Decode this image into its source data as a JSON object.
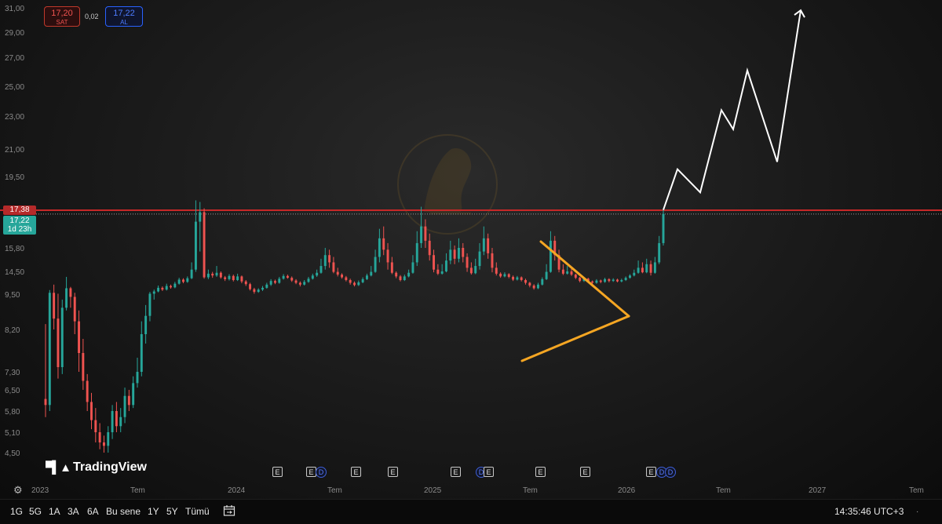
{
  "quote": {
    "sell_price": "17,20",
    "sell_label": "SAT",
    "spread": "0,02",
    "buy_price": "17,22",
    "buy_label": "AL"
  },
  "price_badges": {
    "red_value": "17,38",
    "green_value": "17,22",
    "green_countdown": "1d 23h"
  },
  "brand": "TradingView",
  "bottom_bar": {
    "timeframes": [
      "1G",
      "5G",
      "1A",
      "3A",
      "6A",
      "Bu sene",
      "1Y",
      "5Y",
      "Tümü"
    ],
    "clock": "14:35:46 UTC+3"
  },
  "colors": {
    "up": "#26a69a",
    "down": "#ef5350",
    "resistance": "#c62828",
    "pattern": "#f5a623",
    "projection": "#ffffff"
  },
  "chart_data": {
    "type": "candlestick",
    "y_ticks": [
      "31,00",
      "29,00",
      "27,00",
      "25,00",
      "23,00",
      "21,00",
      "19,50",
      "17,38",
      "15,80",
      "14,50",
      "9,50",
      "8,20",
      "7,30",
      "6,50",
      "5,80",
      "5,10",
      "4,50"
    ],
    "x_ticks": [
      "2023",
      "Tem",
      "2024",
      "Tem",
      "2025",
      "Tem",
      "2026",
      "Tem",
      "2027",
      "Tem"
    ],
    "resistance_level": 17.38,
    "last_price": 17.22,
    "ohlc": [
      [
        6.2,
        6.0,
        8.4,
        5.6
      ],
      [
        6.0,
        9.8,
        10.4,
        5.8
      ],
      [
        9.8,
        8.6,
        11.6,
        8.2
      ],
      [
        8.6,
        7.4,
        9.6,
        7.0
      ],
      [
        7.4,
        9.0,
        9.3,
        7.2
      ],
      [
        9.0,
        10.8,
        13.3,
        8.9
      ],
      [
        10.8,
        9.4,
        11.1,
        9.0
      ],
      [
        9.4,
        8.5,
        9.8,
        8.1
      ],
      [
        8.5,
        7.7,
        8.9,
        7.3
      ],
      [
        7.7,
        6.9,
        8.0,
        6.5
      ],
      [
        6.9,
        6.1,
        7.2,
        5.8
      ],
      [
        6.1,
        5.5,
        6.4,
        5.2
      ],
      [
        5.5,
        5.1,
        5.9,
        4.8
      ],
      [
        5.1,
        4.8,
        5.4,
        4.6
      ],
      [
        4.8,
        4.7,
        5.0,
        4.5
      ],
      [
        4.7,
        5.1,
        5.3,
        4.5
      ],
      [
        5.1,
        5.8,
        6.0,
        4.9
      ],
      [
        5.8,
        5.3,
        6.1,
        5.1
      ],
      [
        5.3,
        5.6,
        5.9,
        5.1
      ],
      [
        5.6,
        6.3,
        6.6,
        5.4
      ],
      [
        6.3,
        6.0,
        6.5,
        5.8
      ],
      [
        6.0,
        6.8,
        7.1,
        5.9
      ],
      [
        6.8,
        7.3,
        7.6,
        6.6
      ],
      [
        7.3,
        8.1,
        8.5,
        7.1
      ],
      [
        8.1,
        8.7,
        9.1,
        7.9
      ],
      [
        8.7,
        9.6,
        10.0,
        8.5
      ],
      [
        9.6,
        10.1,
        10.5,
        9.3
      ],
      [
        10.1,
        10.9,
        11.4,
        9.9
      ],
      [
        10.9,
        10.5,
        11.2,
        10.2
      ],
      [
        10.5,
        11.3,
        11.8,
        10.3
      ],
      [
        11.3,
        11.0,
        11.6,
        10.7
      ],
      [
        11.0,
        11.8,
        12.2,
        10.8
      ],
      [
        11.8,
        12.7,
        13.1,
        11.6
      ],
      [
        12.7,
        12.2,
        13.0,
        11.9
      ],
      [
        12.2,
        13.0,
        13.4,
        12.0
      ],
      [
        13.0,
        14.6,
        15.0,
        12.8
      ],
      [
        14.6,
        16.9,
        18.0,
        14.4
      ],
      [
        16.9,
        17.3,
        17.9,
        15.6
      ],
      [
        17.3,
        13.2,
        17.5,
        12.9
      ],
      [
        13.2,
        14.0,
        14.6,
        12.8
      ],
      [
        14.0,
        13.6,
        14.4,
        13.1
      ],
      [
        13.6,
        14.2,
        14.8,
        13.3
      ],
      [
        14.2,
        13.2,
        14.5,
        12.9
      ],
      [
        13.2,
        12.8,
        13.5,
        12.4
      ],
      [
        12.8,
        13.5,
        13.9,
        12.5
      ],
      [
        13.5,
        12.6,
        13.8,
        12.3
      ],
      [
        12.6,
        13.4,
        14.0,
        12.4
      ],
      [
        13.4,
        12.3,
        13.6,
        11.9
      ],
      [
        12.3,
        11.7,
        12.6,
        11.3
      ],
      [
        11.7,
        10.6,
        12.0,
        10.3
      ],
      [
        10.6,
        10.0,
        10.9,
        9.6
      ],
      [
        10.0,
        10.5,
        10.8,
        9.8
      ],
      [
        10.5,
        10.9,
        11.3,
        10.2
      ],
      [
        10.9,
        11.6,
        12.0,
        10.7
      ],
      [
        11.6,
        12.4,
        12.8,
        11.3
      ],
      [
        12.4,
        12.0,
        12.7,
        11.7
      ],
      [
        12.0,
        12.9,
        13.3,
        11.8
      ],
      [
        12.9,
        13.5,
        13.9,
        12.7
      ],
      [
        13.5,
        13.1,
        13.8,
        12.9
      ],
      [
        13.1,
        12.5,
        13.4,
        12.2
      ],
      [
        12.5,
        12.0,
        12.8,
        11.7
      ],
      [
        12.0,
        11.6,
        12.3,
        11.2
      ],
      [
        11.6,
        12.2,
        12.6,
        11.4
      ],
      [
        12.2,
        12.9,
        13.3,
        12.0
      ],
      [
        12.9,
        13.6,
        14.0,
        12.7
      ],
      [
        13.6,
        14.2,
        14.6,
        13.3
      ],
      [
        14.2,
        14.8,
        15.2,
        14.0
      ],
      [
        14.8,
        15.4,
        15.8,
        14.6
      ],
      [
        15.4,
        15.0,
        15.7,
        14.7
      ],
      [
        15.0,
        14.4,
        15.3,
        14.1
      ],
      [
        14.4,
        13.8,
        14.7,
        13.4
      ],
      [
        13.8,
        13.2,
        14.1,
        12.9
      ],
      [
        13.2,
        12.6,
        13.5,
        12.3
      ],
      [
        12.6,
        12.0,
        12.9,
        11.6
      ],
      [
        12.0,
        11.5,
        12.3,
        11.2
      ],
      [
        11.5,
        12.1,
        12.5,
        11.3
      ],
      [
        12.1,
        12.8,
        13.2,
        11.9
      ],
      [
        12.8,
        13.6,
        14.0,
        12.6
      ],
      [
        13.6,
        14.4,
        14.8,
        13.4
      ],
      [
        14.4,
        15.3,
        15.7,
        14.2
      ],
      [
        15.3,
        16.2,
        16.6,
        15.0
      ],
      [
        16.2,
        15.7,
        16.7,
        15.4
      ],
      [
        15.7,
        15.0,
        16.0,
        14.6
      ],
      [
        15.0,
        14.2,
        15.3,
        13.9
      ],
      [
        14.2,
        13.4,
        14.5,
        13.0
      ],
      [
        13.4,
        12.6,
        13.7,
        12.3
      ],
      [
        12.6,
        13.4,
        13.8,
        12.4
      ],
      [
        13.4,
        14.2,
        14.6,
        13.2
      ],
      [
        14.2,
        15.0,
        15.4,
        14.0
      ],
      [
        15.0,
        16.0,
        16.5,
        14.8
      ],
      [
        16.0,
        16.7,
        17.6,
        15.8
      ],
      [
        16.7,
        16.1,
        17.0,
        15.8
      ],
      [
        16.1,
        15.4,
        16.4,
        15.1
      ],
      [
        15.4,
        14.6,
        15.7,
        14.3
      ],
      [
        14.6,
        14.0,
        14.9,
        13.7
      ],
      [
        14.0,
        14.5,
        14.9,
        13.8
      ],
      [
        14.5,
        15.1,
        15.5,
        14.3
      ],
      [
        15.1,
        15.7,
        16.1,
        14.9
      ],
      [
        15.7,
        15.2,
        15.9,
        14.9
      ],
      [
        15.2,
        15.8,
        16.2,
        15.0
      ],
      [
        15.8,
        15.3,
        16.0,
        15.0
      ],
      [
        15.3,
        14.7,
        15.5,
        14.4
      ],
      [
        14.7,
        14.1,
        15.0,
        13.8
      ],
      [
        14.1,
        14.8,
        15.2,
        13.9
      ],
      [
        14.8,
        15.6,
        16.0,
        14.6
      ],
      [
        15.6,
        16.2,
        16.7,
        15.4
      ],
      [
        16.2,
        15.5,
        16.4,
        15.2
      ],
      [
        15.5,
        14.7,
        15.8,
        14.3
      ],
      [
        14.7,
        14.0,
        15.0,
        13.6
      ],
      [
        14.0,
        13.4,
        14.3,
        13.1
      ],
      [
        13.4,
        13.9,
        14.3,
        13.2
      ],
      [
        13.9,
        13.3,
        14.1,
        13.0
      ],
      [
        13.3,
        12.7,
        13.6,
        12.4
      ],
      [
        12.7,
        13.2,
        13.5,
        12.5
      ],
      [
        13.2,
        12.6,
        13.4,
        12.3
      ],
      [
        12.6,
        12.0,
        12.9,
        11.6
      ],
      [
        12.0,
        11.4,
        12.2,
        11.0
      ],
      [
        11.4,
        10.8,
        11.7,
        10.5
      ],
      [
        10.8,
        11.6,
        12.0,
        10.6
      ],
      [
        11.6,
        12.8,
        13.2,
        11.4
      ],
      [
        12.8,
        14.4,
        14.9,
        12.6
      ],
      [
        14.4,
        16.1,
        16.5,
        14.2
      ],
      [
        16.1,
        15.4,
        16.3,
        15.1
      ],
      [
        15.4,
        14.6,
        15.7,
        14.3
      ],
      [
        14.6,
        14.0,
        14.9,
        13.7
      ],
      [
        14.0,
        14.5,
        14.8,
        13.8
      ],
      [
        14.5,
        13.8,
        14.7,
        13.5
      ],
      [
        13.8,
        13.1,
        14.0,
        12.8
      ],
      [
        13.1,
        12.4,
        13.3,
        12.1
      ],
      [
        12.4,
        12.9,
        13.2,
        12.2
      ],
      [
        12.9,
        12.3,
        13.1,
        12.0
      ],
      [
        12.3,
        12.0,
        12.5,
        11.7
      ],
      [
        12.0,
        12.5,
        12.8,
        11.8
      ],
      [
        12.5,
        12.2,
        12.7,
        11.9
      ],
      [
        12.2,
        12.8,
        13.1,
        12.0
      ],
      [
        12.8,
        12.4,
        13.0,
        12.1
      ],
      [
        12.4,
        12.7,
        13.0,
        12.2
      ],
      [
        12.7,
        12.3,
        12.9,
        12.1
      ],
      [
        12.3,
        12.6,
        12.9,
        12.1
      ],
      [
        12.6,
        13.1,
        13.4,
        12.4
      ],
      [
        13.1,
        13.6,
        13.9,
        12.9
      ],
      [
        13.6,
        14.2,
        14.6,
        13.4
      ],
      [
        14.2,
        14.7,
        15.1,
        14.0
      ],
      [
        14.7,
        14.3,
        15.0,
        14.1
      ],
      [
        14.3,
        14.9,
        15.2,
        14.1
      ],
      [
        14.9,
        14.2,
        15.1,
        13.6
      ],
      [
        14.2,
        15.0,
        15.3,
        14.0
      ],
      [
        15.0,
        16.0,
        16.3,
        14.9
      ],
      [
        16.0,
        17.22,
        17.4,
        15.9
      ]
    ],
    "projection": [
      17.4,
      19.9,
      18.5,
      23.4,
      22.2,
      26.1,
      20.3,
      30.8
    ],
    "pattern": "symmetrical triangle breakout"
  }
}
